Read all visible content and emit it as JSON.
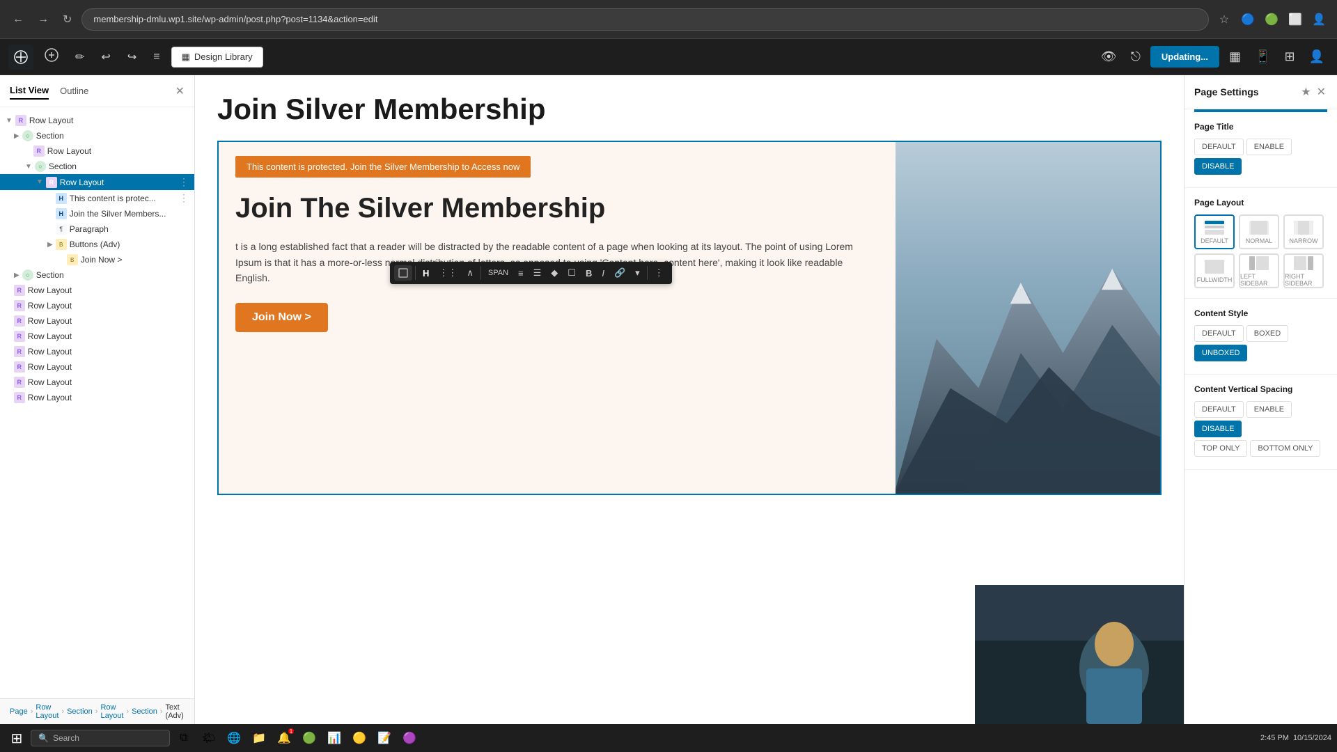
{
  "browser": {
    "url": "membership-dmlu.wp1.site/wp-admin/post.php?post=1134&action=edit",
    "nav_back": "←",
    "nav_forward": "→",
    "nav_refresh": "↻"
  },
  "toolbar": {
    "wp_logo": "W",
    "add_label": "+",
    "edit_label": "✏",
    "undo_label": "↩",
    "redo_label": "↪",
    "menu_label": "≡",
    "design_library_label": "Design Library",
    "updating_label": "Updating...",
    "view_label": "👁",
    "preview_label": "⎋",
    "settings_label": "⚙",
    "responsive_label": "📱",
    "user_label": "👤"
  },
  "left_panel": {
    "list_view_tab": "List View",
    "outline_tab": "Outline",
    "close_btn": "✕",
    "tree_items": [
      {
        "label": "Row Layout",
        "indent": 0,
        "icon_type": "row",
        "has_chevron": true,
        "chevron": "▼"
      },
      {
        "label": "Section",
        "indent": 1,
        "icon_type": "section",
        "has_chevron": true,
        "chevron": "▶"
      },
      {
        "label": "Row Layout",
        "indent": 2,
        "icon_type": "row",
        "has_chevron": false,
        "chevron": ""
      },
      {
        "label": "Section",
        "indent": 2,
        "icon_type": "section",
        "has_chevron": true,
        "chevron": "▼"
      },
      {
        "label": "Row Layout",
        "indent": 3,
        "icon_type": "row",
        "has_chevron": false,
        "chevron": "",
        "active": true
      },
      {
        "label": "This content is protec...",
        "indent": 4,
        "icon_type": "h",
        "has_chevron": false,
        "chevron": "",
        "dots": true
      },
      {
        "label": "Join the Silver Members...",
        "indent": 4,
        "icon_type": "h",
        "has_chevron": false,
        "chevron": ""
      },
      {
        "label": "Paragraph",
        "indent": 4,
        "icon_type": "para",
        "has_chevron": false,
        "chevron": ""
      },
      {
        "label": "Buttons (Adv)",
        "indent": 4,
        "icon_type": "btn",
        "has_chevron": true,
        "chevron": "▶"
      },
      {
        "label": "Join Now >",
        "indent": 5,
        "icon_type": "btn",
        "has_chevron": false,
        "chevron": ""
      },
      {
        "label": "Section",
        "indent": 1,
        "icon_type": "section",
        "has_chevron": false,
        "chevron": "▶"
      },
      {
        "label": "Row Layout",
        "indent": 0,
        "icon_type": "row",
        "has_chevron": false,
        "chevron": ""
      },
      {
        "label": "Row Layout",
        "indent": 0,
        "icon_type": "row",
        "has_chevron": false,
        "chevron": ""
      },
      {
        "label": "Row Layout",
        "indent": 0,
        "icon_type": "row",
        "has_chevron": false,
        "chevron": ""
      },
      {
        "label": "Row Layout",
        "indent": 0,
        "icon_type": "row",
        "has_chevron": false,
        "chevron": ""
      },
      {
        "label": "Row Layout",
        "indent": 0,
        "icon_type": "row",
        "has_chevron": false,
        "chevron": ""
      },
      {
        "label": "Row Layout",
        "indent": 0,
        "icon_type": "row",
        "has_chevron": false,
        "chevron": ""
      },
      {
        "label": "Row Layout",
        "indent": 0,
        "icon_type": "row",
        "has_chevron": false,
        "chevron": ""
      },
      {
        "label": "Row Layout",
        "indent": 0,
        "icon_type": "row",
        "has_chevron": false,
        "chevron": ""
      }
    ],
    "breadcrumbs": [
      "Page",
      "Row Layout",
      "Section",
      "Row Layout",
      "Section",
      "Text (Adv)"
    ],
    "search_placeholder": "Search"
  },
  "canvas": {
    "page_title": "Join Silver Membership",
    "protected_banner": "This content is protected. Join the Silver Membership to Access now",
    "section_heading": "Join The Silver Membership",
    "body_text": "t is a long established fact that a reader will be distracted by the readable content of a page when looking at its layout. The point of using Lorem Ipsum is that it has a more-or-less normal distribution of letters, as opposed to using 'Content here, content here', making it look like readable English.",
    "join_btn": "Join Now >"
  },
  "block_toolbar": {
    "h_label": "H",
    "dots_label": "⋮⋮",
    "chevron_up": "∧",
    "span_label": "SPAN",
    "align_label": "≡",
    "list_label": "☰",
    "diamond_label": "◆",
    "box_label": "☐",
    "bold_label": "B",
    "italic_label": "I",
    "link_label": "🔗",
    "dropdown_label": "▾",
    "more_label": "⋮"
  },
  "right_panel": {
    "title": "Page Settings",
    "star_btn": "★",
    "close_btn": "✕",
    "page_title_label": "Page Title",
    "page_title_btns": [
      "DEFAULT",
      "ENABLE",
      "DISABLE"
    ],
    "page_title_active": "DISABLE",
    "page_layout_label": "Page Layout",
    "layouts": [
      {
        "label": "DEFAULT",
        "active": true
      },
      {
        "label": "NORMAL",
        "active": false
      },
      {
        "label": "NARROW",
        "active": false
      },
      {
        "label": "FULLWIDTH",
        "active": false
      },
      {
        "label": "LEFT SIDEBAR",
        "active": false
      },
      {
        "label": "RIGHT SIDEBAR",
        "active": false
      }
    ],
    "content_style_label": "Content Style",
    "content_style_btns": [
      "DEFAULT",
      "BOXED",
      "UNBOXED"
    ],
    "content_style_active": "UNBOXED",
    "content_spacing_label": "Content Vertical Spacing",
    "content_spacing_btns": [
      "DEFAULT",
      "ENABLE",
      "DISABLE",
      "TOP ONLY",
      "BOTTOM ONLY"
    ],
    "content_spacing_active": "DISABLE"
  },
  "taskbar": {
    "search_text": "Search",
    "time": "2:45 PM",
    "date": "10/15/2024"
  }
}
